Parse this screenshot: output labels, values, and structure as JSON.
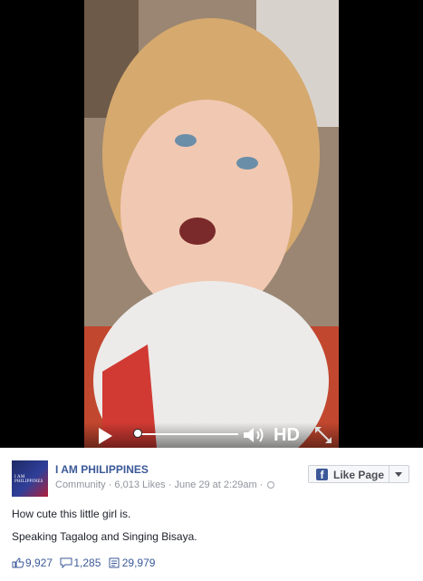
{
  "video": {
    "hd_label": "HD",
    "progress": 0.0
  },
  "post": {
    "page_name": "I AM PHILIPPINES",
    "category": "Community",
    "likes_text": "6,013 Likes",
    "timestamp": "June 29 at 2:29am",
    "like_page_button": "Like Page",
    "message_lines": [
      "How cute this little girl is.",
      "Speaking Tagalog and Singing Bisaya."
    ],
    "stats": {
      "likes": "9,927",
      "comments": "1,285",
      "shares": "29,979"
    },
    "logo_text": "I AM PHILIPPINES"
  },
  "colors": {
    "link": "#3b5998",
    "meta": "#90949c",
    "video_bg": "#000000"
  }
}
